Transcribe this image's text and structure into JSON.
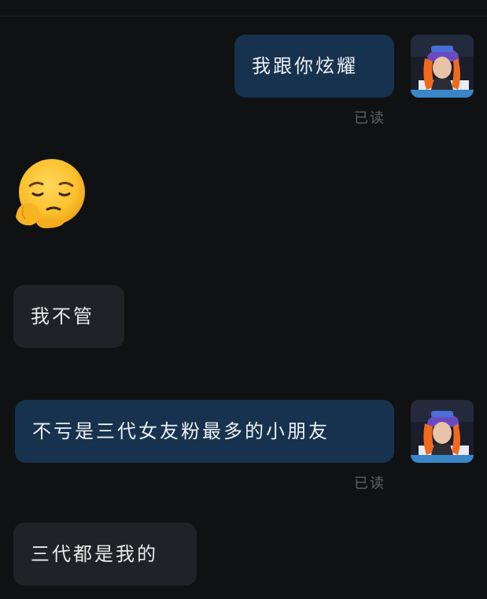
{
  "chat": {
    "messages": [
      {
        "side": "sent",
        "text": "我跟你炫耀",
        "status": "已读"
      },
      {
        "side": "recv",
        "emoji": "pensive-face-emoji"
      },
      {
        "side": "recv",
        "text": "我不管"
      },
      {
        "side": "sent",
        "text": "不亏是三代女友粉最多的小朋友",
        "status": "已读"
      },
      {
        "side": "recv",
        "text": "三代都是我的"
      }
    ]
  },
  "colors": {
    "background": "#0f1113",
    "sent_bubble": "#16324e",
    "received_bubble": "#1f2327",
    "read_receipt": "#5c6166"
  }
}
